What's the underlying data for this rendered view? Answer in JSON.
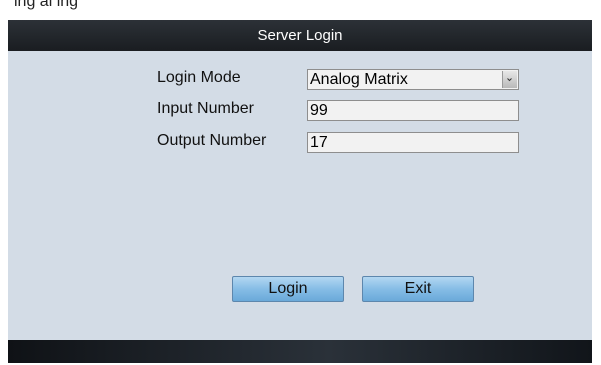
{
  "background_caption": "ing         al         ing",
  "dialog": {
    "title": "Server Login",
    "fields": {
      "login_mode": {
        "label": "Login Mode",
        "value": "Analog Matrix"
      },
      "input_number": {
        "label": "Input Number",
        "value": "99"
      },
      "output_number": {
        "label": "Output Number",
        "value": "17"
      }
    },
    "buttons": {
      "login": "Login",
      "exit": "Exit"
    }
  }
}
